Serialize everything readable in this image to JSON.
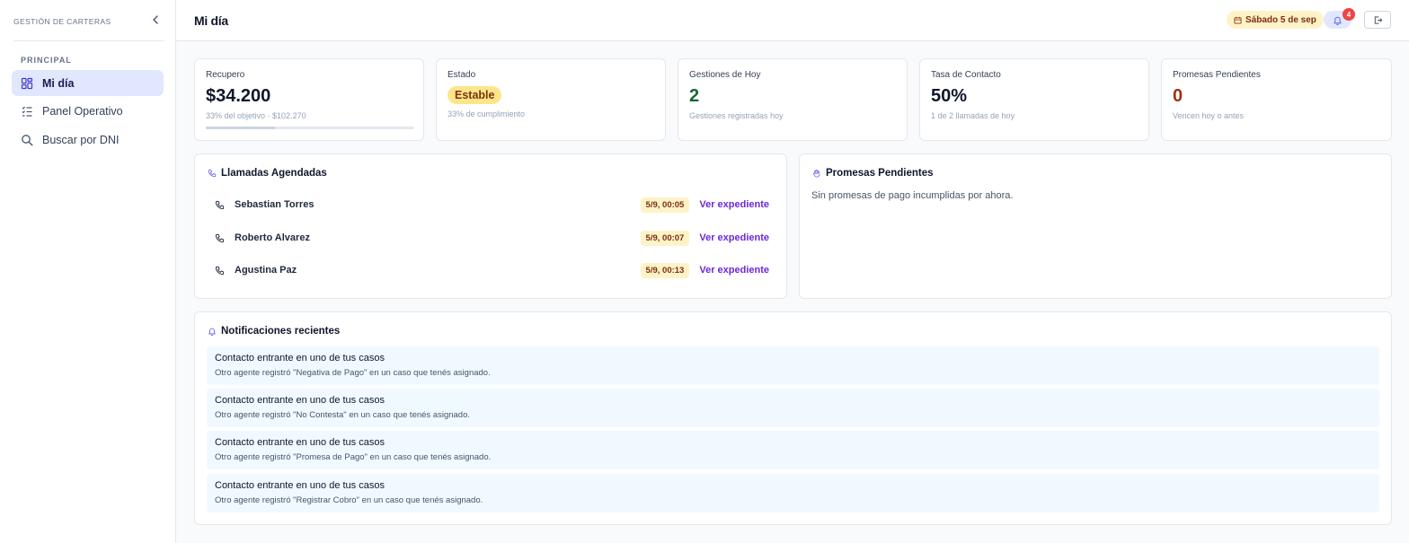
{
  "sidebar": {
    "brand": "GESTIÓN DE CARTERAS",
    "section": "PRINCIPAL",
    "items": [
      {
        "label": "Mi día",
        "icon": "dashboard-icon"
      },
      {
        "label": "Panel Operativo",
        "icon": "list-icon"
      },
      {
        "label": "Buscar por DNI",
        "icon": "search-icon"
      }
    ]
  },
  "header": {
    "title": "Mi día",
    "date": "Sábado 5 de sep",
    "notifications_count": "4"
  },
  "kpis": {
    "recupero": {
      "label": "Recupero",
      "value": "$34.200",
      "sub": "33% del objetivo · $102.270",
      "progress": 0.33
    },
    "estado": {
      "label": "Estado",
      "value": "Estable",
      "sub": "33% de cumplimiento"
    },
    "gestiones": {
      "label": "Gestiones de Hoy",
      "value": "2",
      "sub": "Gestiones registradas hoy",
      "color": "#166534"
    },
    "tasa": {
      "label": "Tasa de Contacto",
      "value": "50%",
      "sub": "1 de 2 llamadas de hoy"
    },
    "promesas": {
      "label": "Promesas Pendientes",
      "value": "0",
      "sub": "Vencen hoy o antes",
      "color": "#9a3412"
    }
  },
  "calls": {
    "title": "Llamadas Agendadas",
    "link_label": "Ver expediente",
    "items": [
      {
        "name": "Sebastian Torres",
        "time": "5/9, 00:05"
      },
      {
        "name": "Roberto Alvarez",
        "time": "5/9, 00:07"
      },
      {
        "name": "Agustina Paz",
        "time": "5/9, 00:13"
      }
    ]
  },
  "promises": {
    "title": "Promesas Pendientes",
    "empty": "Sin promesas de pago incumplidas por ahora."
  },
  "notifications": {
    "title": "Notificaciones recientes",
    "items": [
      {
        "title": "Contacto entrante en uno de tus casos",
        "desc": "Otro agente registró \"Negativa de Pago\" en un caso que tenés asignado."
      },
      {
        "title": "Contacto entrante en uno de tus casos",
        "desc": "Otro agente registró \"No Contesta\" en un caso que tenés asignado."
      },
      {
        "title": "Contacto entrante en uno de tus casos",
        "desc": "Otro agente registró \"Promesa de Pago\" en un caso que tenés asignado."
      },
      {
        "title": "Contacto entrante en uno de tus casos",
        "desc": "Otro agente registró \"Registrar Cobro\" en un caso que tenés asignado."
      }
    ]
  }
}
